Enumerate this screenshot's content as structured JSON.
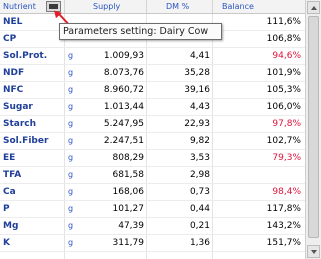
{
  "header": {
    "nutrient": "Nutrient",
    "supply": "Supply",
    "dm_percent": "DM %",
    "balance": "Balance",
    "parameters_button_icon": "table-settings-icon"
  },
  "tooltip": {
    "text": "Parameters setting: Dairy Cow"
  },
  "rows": [
    {
      "nutrient": "NEL",
      "unit": "",
      "supply": "",
      "dm": "",
      "balance": "111,6%"
    },
    {
      "nutrient": "CP",
      "unit": "",
      "supply": "",
      "dm": "",
      "balance": "106,8%"
    },
    {
      "nutrient": "Sol.Prot.",
      "unit": "g",
      "supply": "1.009,93",
      "dm": "4,41",
      "balance": "94,6%"
    },
    {
      "nutrient": "NDF",
      "unit": "g",
      "supply": "8.073,76",
      "dm": "35,28",
      "balance": "101,9%"
    },
    {
      "nutrient": "NFC",
      "unit": "g",
      "supply": "8.960,72",
      "dm": "39,16",
      "balance": "105,3%"
    },
    {
      "nutrient": "Sugar",
      "unit": "g",
      "supply": "1.013,44",
      "dm": "4,43",
      "balance": "106,0%"
    },
    {
      "nutrient": "Starch",
      "unit": "g",
      "supply": "5.247,95",
      "dm": "22,93",
      "balance": "97,8%"
    },
    {
      "nutrient": "Sol.Fiber",
      "unit": "g",
      "supply": "2.247,51",
      "dm": "9,82",
      "balance": "102,7%"
    },
    {
      "nutrient": "EE",
      "unit": "g",
      "supply": "808,29",
      "dm": "3,53",
      "balance": "79,3%"
    },
    {
      "nutrient": "TFA",
      "unit": "g",
      "supply": "681,58",
      "dm": "2,98",
      "balance": ""
    },
    {
      "nutrient": "Ca",
      "unit": "g",
      "supply": "168,06",
      "dm": "0,73",
      "balance": "98,4%"
    },
    {
      "nutrient": "P",
      "unit": "g",
      "supply": "101,27",
      "dm": "0,44",
      "balance": "117,8%"
    },
    {
      "nutrient": "Mg",
      "unit": "g",
      "supply": "47,39",
      "dm": "0,21",
      "balance": "143,2%"
    },
    {
      "nutrient": "K",
      "unit": "g",
      "supply": "311,79",
      "dm": "1,36",
      "balance": "151,7%"
    }
  ],
  "colors": {
    "balance_low": "#e0123a",
    "nutrient_label": "#1f3f9a",
    "unit_label": "#2d55c8",
    "annotation_arrow": "#e01e2a"
  },
  "low_balance_rows": [
    "Sol.Prot.",
    "Starch",
    "EE",
    "Ca"
  ]
}
